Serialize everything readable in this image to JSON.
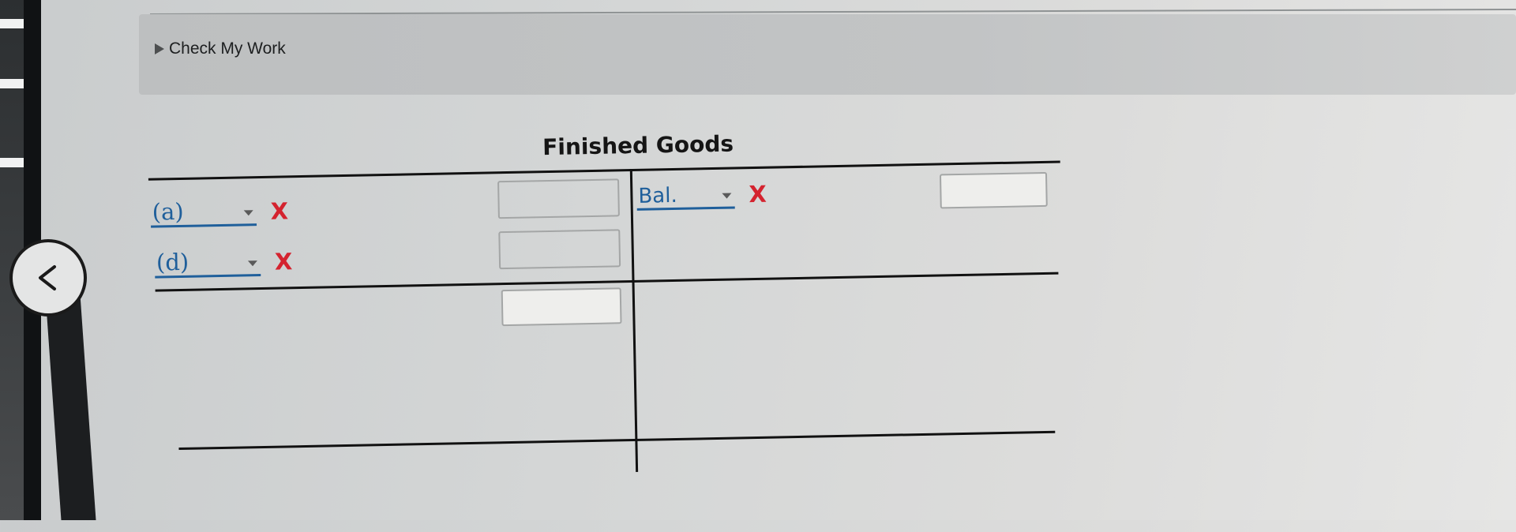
{
  "header": {
    "check_my_work": "Check My Work"
  },
  "nav": {
    "back_icon": "chevron-left-icon"
  },
  "account": {
    "title": "Finished Goods",
    "debit_entries": [
      {
        "label": "(a)",
        "status": "X",
        "amount": ""
      },
      {
        "label": "(d)",
        "status": "X",
        "amount": ""
      }
    ],
    "debit_total": "",
    "credit_entries": [
      {
        "label": "Bal.",
        "status": "X",
        "amount": ""
      }
    ]
  },
  "colors": {
    "link_blue": "#1f5f9b",
    "incorrect_red": "#d4232f"
  }
}
